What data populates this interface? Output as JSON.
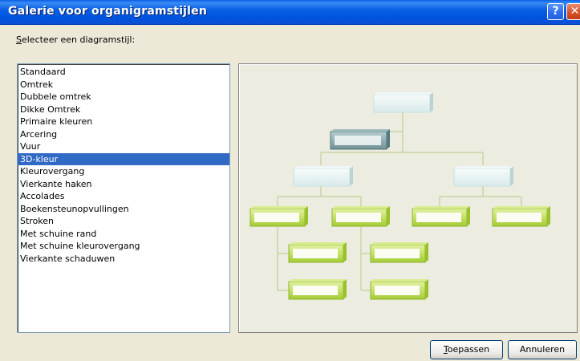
{
  "window": {
    "title": "Galerie voor organigramstijlen",
    "help_glyph": "?",
    "close_glyph": "✕"
  },
  "prompt": {
    "accel": "S",
    "rest": "electeer een diagramstijl:"
  },
  "styles": {
    "items": [
      "Standaard",
      "Omtrek",
      "Dubbele omtrek",
      "Dikke Omtrek",
      "Primaire kleuren",
      "Arcering",
      "Vuur",
      "3D-kleur",
      "Kleurovergang",
      "Vierkante haken",
      "Accolades",
      "Boekensteunopvullingen",
      "Stroken",
      "Met schuine rand",
      "Met schuine kleurovergang",
      "Vierkante schaduwen"
    ],
    "selected_index": 7
  },
  "buttons": {
    "apply_accel": "T",
    "apply_rest": "oepassen",
    "cancel": "Annuleren"
  },
  "colors": {
    "selection": "#316ac5",
    "connector": "#c7d6a4",
    "green_box": "#b6d94a",
    "teal_box": "#7c9fa3",
    "light_box": "#dcebec"
  }
}
